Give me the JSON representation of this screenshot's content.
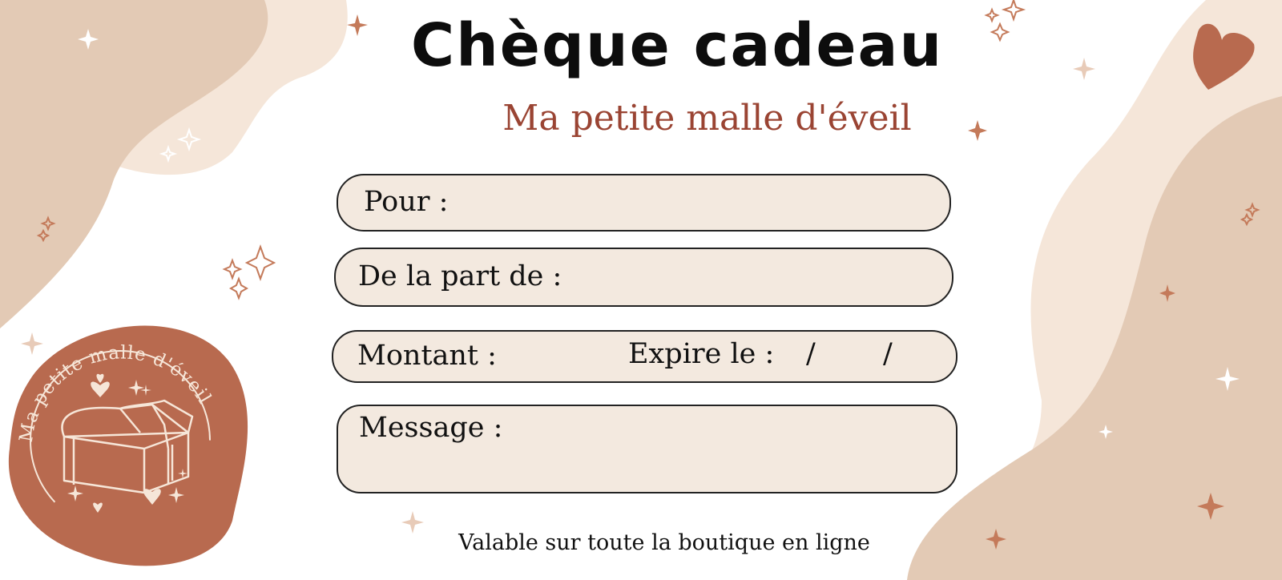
{
  "title": "Chèque cadeau",
  "subtitle": "Ma petite malle d'éveil",
  "fields": {
    "for_label": "Pour :",
    "from_label": "De la part de :",
    "amount_label": "Montant :",
    "expiry_label": "Expire le :",
    "date_separator": "/",
    "message_label": "Message :"
  },
  "footer": "Valable sur toute la boutique en ligne",
  "logo": {
    "text": "Ma petite malle d'éveil",
    "icon": "treasure-chest-icon"
  },
  "colors": {
    "terracotta": "#b86a4f",
    "beige": "#e3cab5",
    "light_beige": "#f5e6d9",
    "field_fill": "#f3e9df",
    "subtitle": "#9a4433"
  }
}
